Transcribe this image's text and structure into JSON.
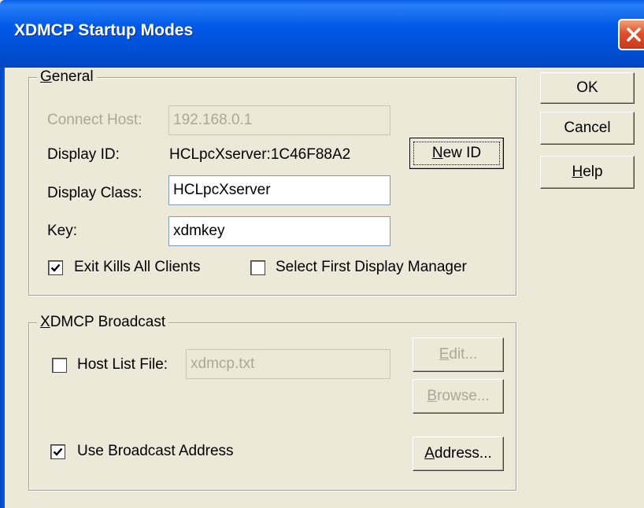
{
  "window": {
    "title": "XDMCP Startup Modes"
  },
  "general": {
    "legend_first": "G",
    "legend_rest": "eneral",
    "connect_host": {
      "label": "Connect Host:",
      "value": "192.168.0.1",
      "enabled": false
    },
    "display_id": {
      "label": "Display ID:",
      "value": "HCLpcXserver:1C46F88A2"
    },
    "new_id_button": {
      "first": "N",
      "rest": "ew ID"
    },
    "display_class": {
      "label": "Display Class:",
      "value": "HCLpcXserver"
    },
    "key": {
      "label": "Key:",
      "value": "xdmkey"
    },
    "exit_kills": {
      "label": "Exit Kills All Clients",
      "checked": true
    },
    "select_first": {
      "label": "Select First Display Manager",
      "checked": false
    }
  },
  "broadcast": {
    "legend_first": "X",
    "legend_rest": "DMCP Broadcast",
    "host_list": {
      "label": "Host List File:",
      "value": "xdmcp.txt",
      "checked": false,
      "enabled": false
    },
    "edit_button": {
      "first": "E",
      "rest": "dit...",
      "enabled": false
    },
    "browse_button": {
      "first": "B",
      "rest": "rowse...",
      "enabled": false
    },
    "use_broadcast": {
      "label": "Use Broadcast Address",
      "checked": true
    },
    "address_button": {
      "first": "A",
      "rest": "ddress...",
      "enabled": true
    }
  },
  "buttons": {
    "ok": "OK",
    "cancel": "Cancel",
    "help_first": "H",
    "help_rest": "elp"
  }
}
